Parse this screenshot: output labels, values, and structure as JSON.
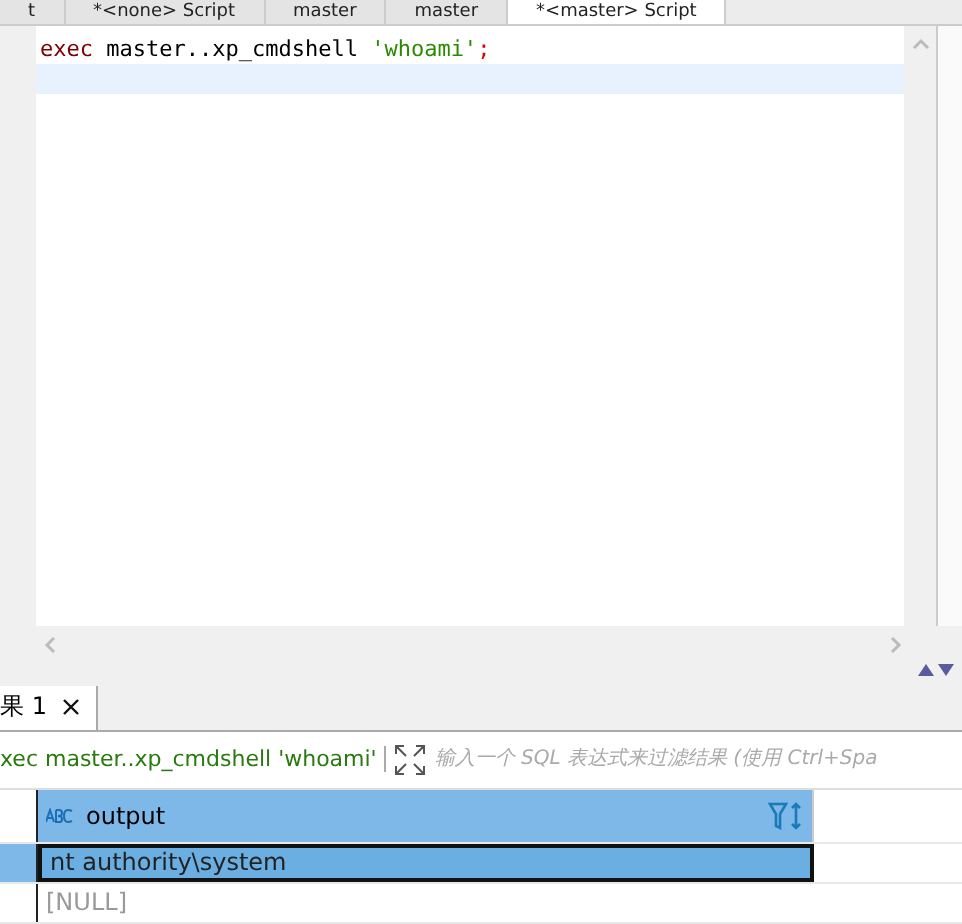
{
  "editor_tabs": [
    {
      "label": "t",
      "selected": false
    },
    {
      "label": "*<none> Script",
      "selected": false
    },
    {
      "label": "master",
      "selected": false
    },
    {
      "label": "master",
      "selected": false
    },
    {
      "label": "*<master> Script",
      "selected": true
    }
  ],
  "editor": {
    "lines": [
      {
        "tokens": [
          {
            "kind": "keyword",
            "text": "exec"
          },
          {
            "kind": "plain",
            "text": " master..xp_cmdshell "
          },
          {
            "kind": "string",
            "text": "'whoami'"
          },
          {
            "kind": "punct",
            "text": ";"
          }
        ],
        "current": false
      },
      {
        "current": true
      }
    ]
  },
  "result_tabs": [
    {
      "label": "果 1",
      "selected": true
    }
  ],
  "filter": {
    "query": "xec master..xp_cmdshell 'whoami'",
    "placeholder": "输入一个 SQL 表达式来过滤结果 (使用 Ctrl+Spa"
  },
  "grid": {
    "columns": [
      {
        "label": "output"
      }
    ],
    "rows": [
      {
        "cells": [
          "nt authority\\system"
        ],
        "selected": true,
        "null": false
      },
      {
        "cells": [
          "[NULL]"
        ],
        "selected": false,
        "null": true
      }
    ]
  }
}
